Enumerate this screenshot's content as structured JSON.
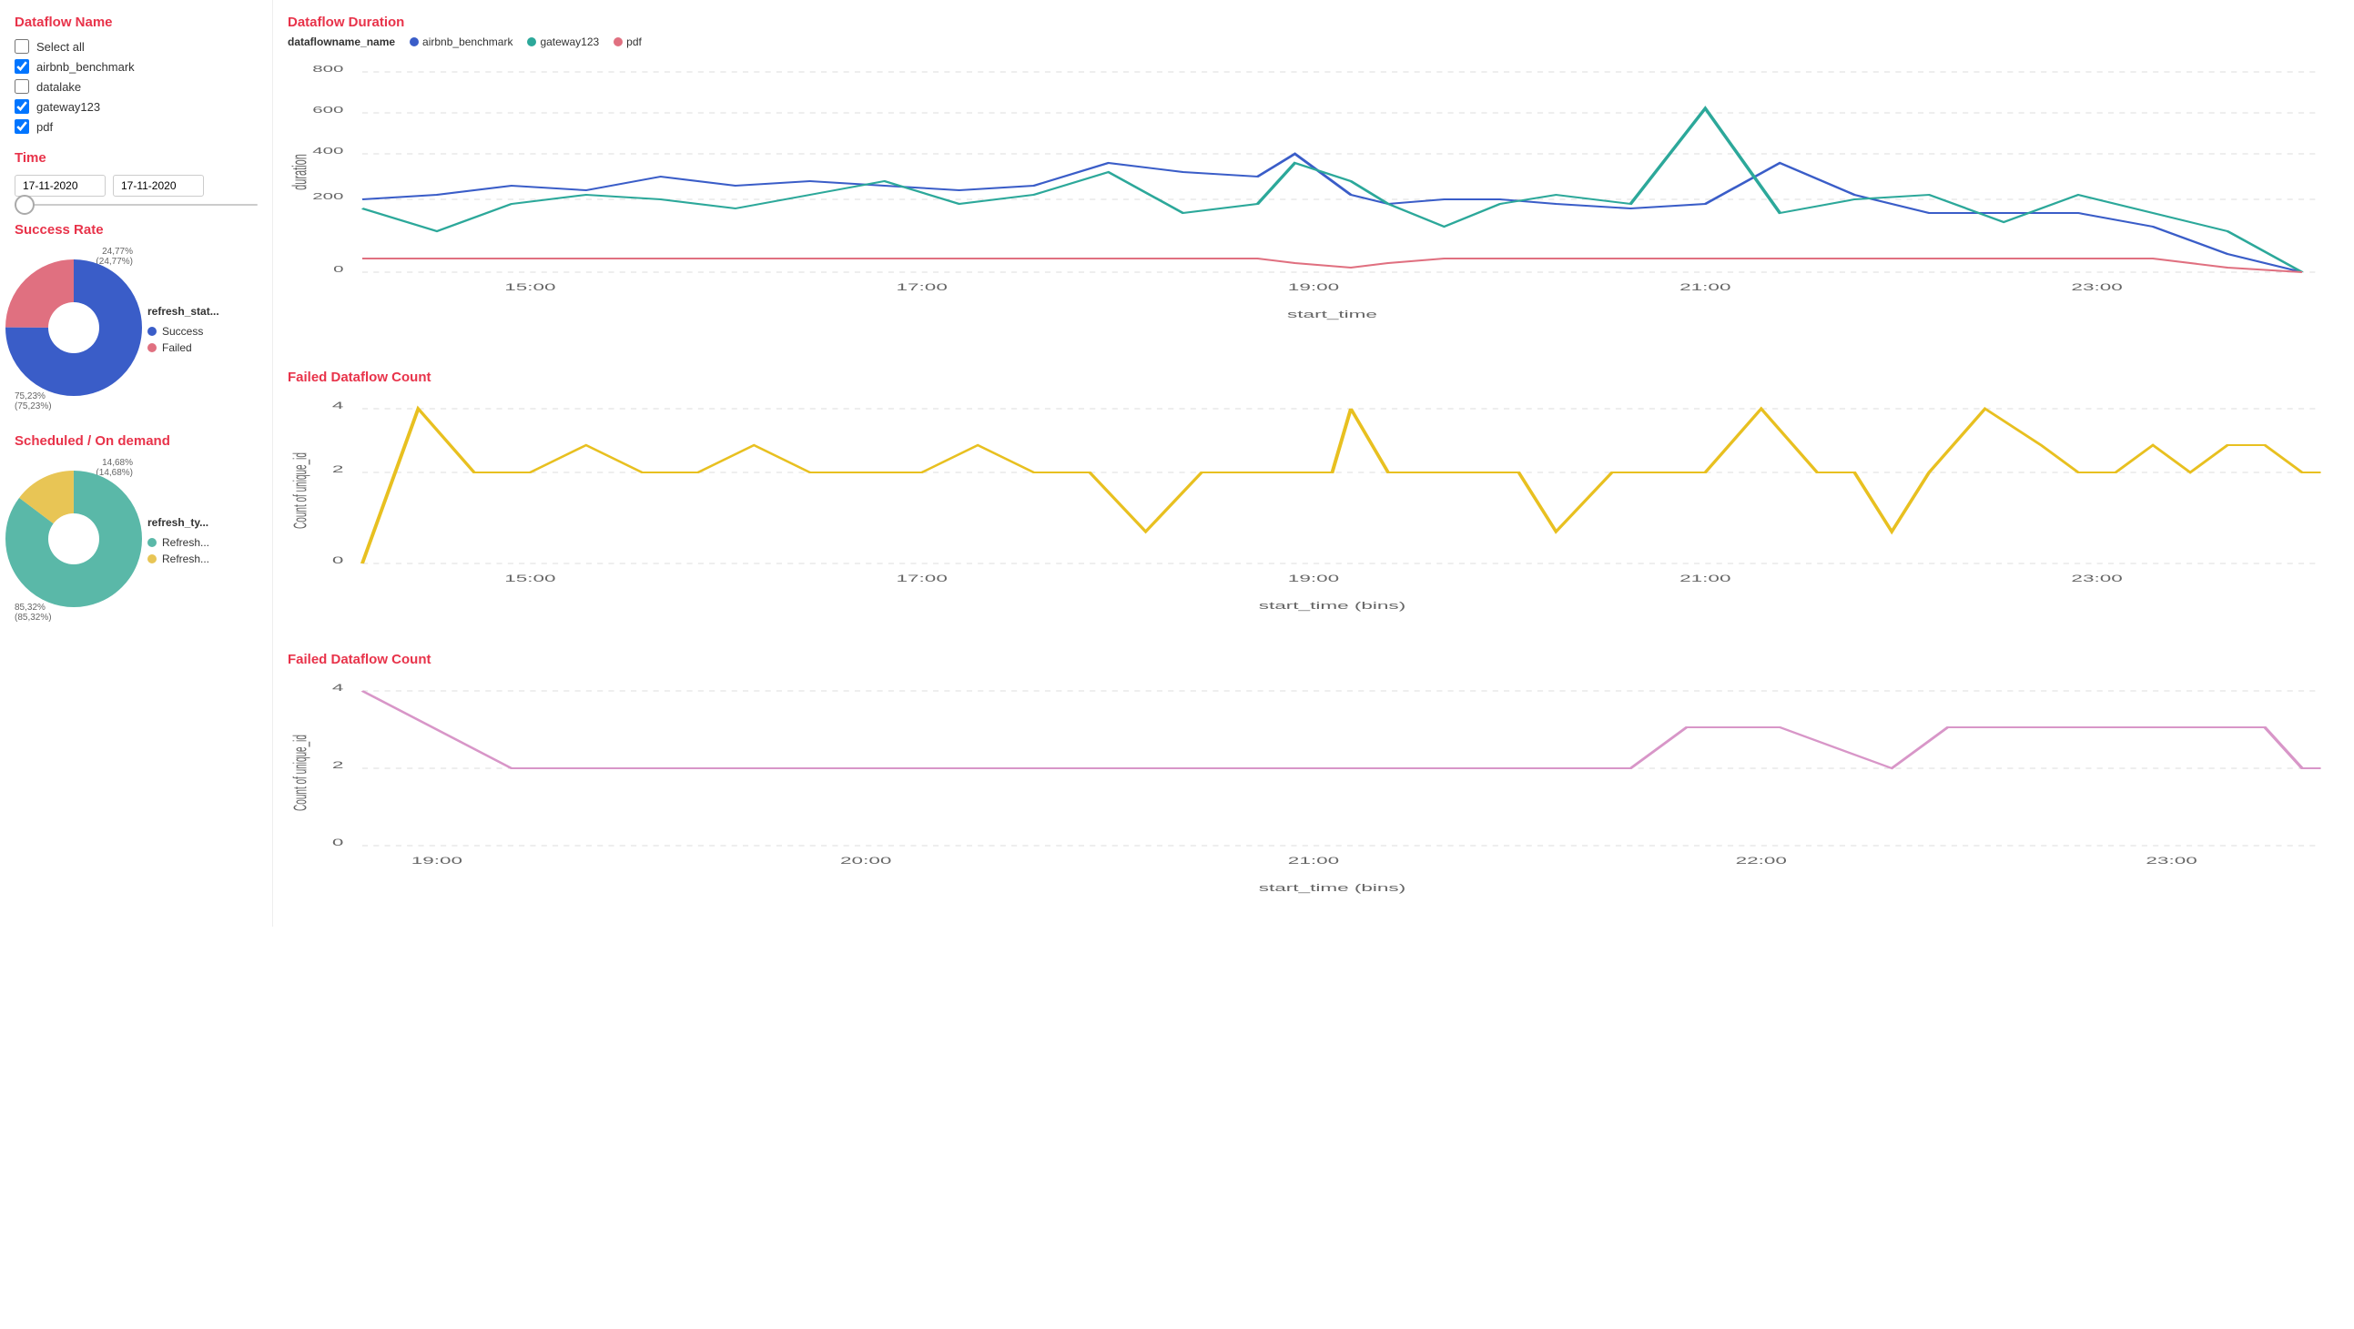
{
  "left": {
    "dataflow_title": "Dataflow Name",
    "select_all_label": "Select all",
    "checkboxes": [
      {
        "label": "airbnb_benchmark",
        "checked": true
      },
      {
        "label": "datalake",
        "checked": false
      },
      {
        "label": "gateway123",
        "checked": true
      },
      {
        "label": "pdf",
        "checked": true
      }
    ],
    "time_title": "Time",
    "date_from": "17-11-2020",
    "date_to": "17-11-2020",
    "success_title": "Success Rate",
    "success_legend_title": "refresh_stat...",
    "success_segments": [
      {
        "label": "Success",
        "color": "#3a5dc8",
        "pct": 75.23
      },
      {
        "label": "Failed",
        "color": "#e07080",
        "pct": 24.77
      }
    ],
    "success_pct_outer": "24,77%\n(24,77%)",
    "success_pct_inner": "75,23%\n(75,23%)",
    "scheduled_title": "Scheduled / On demand",
    "scheduled_legend_title": "refresh_ty...",
    "scheduled_segments": [
      {
        "label": "Refresh...",
        "color": "#5ab8a8",
        "pct": 85.32
      },
      {
        "label": "Refresh...",
        "color": "#e8c555",
        "pct": 14.68
      }
    ],
    "scheduled_pct_outer": "14,68%\n(14,68%)",
    "scheduled_pct_inner": "85,32%\n(85,32%)"
  },
  "charts": {
    "duration_title": "Dataflow Duration",
    "duration_legend": {
      "field": "dataflowname_name",
      "items": [
        {
          "label": "airbnb_benchmark",
          "color": "#3a5dc8"
        },
        {
          "label": "gateway123",
          "color": "#2ca89a"
        },
        {
          "label": "pdf",
          "color": "#e07080"
        }
      ]
    },
    "duration_xaxis": "start_time",
    "duration_yaxis": "duration",
    "failed_count_title": "Failed Dataflow Count",
    "failed_count_xaxis": "start_time (bins)",
    "failed_count_yaxis": "Count of unique_id",
    "failed_count2_title": "Failed Dataflow Count",
    "failed_count2_xaxis": "start_time (bins)",
    "failed_count2_yaxis": "Count of unique_id"
  }
}
